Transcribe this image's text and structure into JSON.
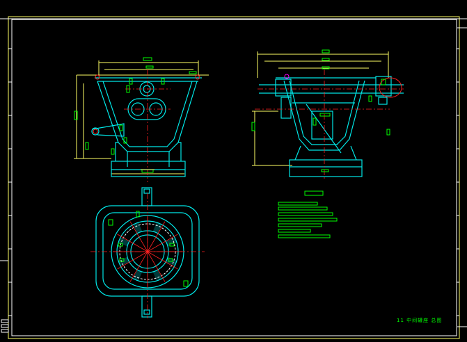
{
  "app": {
    "kind": "cad-drawing-viewport"
  },
  "title_block": {
    "caption": "11 中间罐座 总图"
  },
  "colors": {
    "background": "#000000",
    "outline_cyan": "#00e6e6",
    "dimension_yellow": "#ffff66",
    "centerline_red": "#ff2020",
    "text_green": "#00ff00",
    "frame_white": "#ffffff",
    "highlight_magenta": "#ff00ff"
  },
  "views": [
    {
      "name": "front-view"
    },
    {
      "name": "side-view"
    },
    {
      "name": "top-view"
    }
  ],
  "notes": {
    "lines": 6
  }
}
